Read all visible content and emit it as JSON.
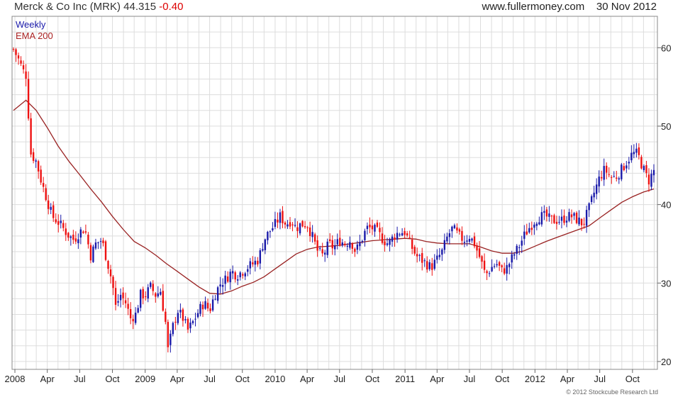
{
  "header": {
    "security": "Merck & Co Inc (MRK) 44.315",
    "change": "-0.40",
    "site": "www.fullermoney.com",
    "date": "30 Nov 2012"
  },
  "copyright": "© 2012 Stockcube Research Ltd",
  "colors": {
    "up_candle": "#1a1aaa",
    "down_candle": "#ee1111",
    "ema_line": "#992222",
    "grid": "#dddddd",
    "frame": "#888888"
  },
  "chart_data": {
    "type": "candlestick",
    "legend": [
      "Weekly",
      "EMA 200"
    ],
    "grid": true,
    "y_axis_side": "right",
    "ylim": [
      19,
      64
    ],
    "y_ticks": [
      20,
      30,
      40,
      50,
      60
    ],
    "x_domain": [
      "2007-12-24",
      "2012-12-10"
    ],
    "x_ticks": [
      {
        "label": "2008",
        "date": "2008-01-01"
      },
      {
        "label": "Apr",
        "date": "2008-04-01"
      },
      {
        "label": "Jul",
        "date": "2008-07-01"
      },
      {
        "label": "Oct",
        "date": "2008-10-01"
      },
      {
        "label": "2009",
        "date": "2009-01-01"
      },
      {
        "label": "Apr",
        "date": "2009-04-01"
      },
      {
        "label": "Jul",
        "date": "2009-07-01"
      },
      {
        "label": "Oct",
        "date": "2009-10-01"
      },
      {
        "label": "2010",
        "date": "2010-01-01"
      },
      {
        "label": "Apr",
        "date": "2010-04-01"
      },
      {
        "label": "Jul",
        "date": "2010-07-01"
      },
      {
        "label": "Oct",
        "date": "2010-10-01"
      },
      {
        "label": "2011",
        "date": "2011-01-01"
      },
      {
        "label": "Apr",
        "date": "2011-04-01"
      },
      {
        "label": "Jul",
        "date": "2011-07-01"
      },
      {
        "label": "Oct",
        "date": "2011-10-01"
      },
      {
        "label": "2012",
        "date": "2012-01-01"
      },
      {
        "label": "Apr",
        "date": "2012-04-01"
      },
      {
        "label": "Jul",
        "date": "2012-07-01"
      },
      {
        "label": "Oct",
        "date": "2012-10-01"
      }
    ],
    "series": [
      {
        "name": "Weekly",
        "kind": "weekly candles (close path)",
        "points": [
          [
            "2007-12-28",
            59.8
          ],
          [
            "2008-01-11",
            58.5
          ],
          [
            "2008-01-25",
            57.0
          ],
          [
            "2008-02-01",
            56.5
          ],
          [
            "2008-02-15",
            46.5
          ],
          [
            "2008-03-01",
            45.5
          ],
          [
            "2008-03-15",
            43.0
          ],
          [
            "2008-04-01",
            40.5
          ],
          [
            "2008-04-15",
            38.5
          ],
          [
            "2008-05-01",
            37.8
          ],
          [
            "2008-05-15",
            37.0
          ],
          [
            "2008-06-01",
            36.0
          ],
          [
            "2008-06-15",
            35.5
          ],
          [
            "2008-07-01",
            36.5
          ],
          [
            "2008-07-15",
            37.0
          ],
          [
            "2008-08-01",
            33.5
          ],
          [
            "2008-08-15",
            35.0
          ],
          [
            "2008-09-01",
            35.5
          ],
          [
            "2008-09-15",
            33.0
          ],
          [
            "2008-10-01",
            30.0
          ],
          [
            "2008-10-10",
            27.0
          ],
          [
            "2008-10-24",
            28.5
          ],
          [
            "2008-11-07",
            27.5
          ],
          [
            "2008-11-21",
            25.5
          ],
          [
            "2008-12-05",
            26.0
          ],
          [
            "2008-12-19",
            28.5
          ],
          [
            "2009-01-02",
            28.5
          ],
          [
            "2009-01-16",
            29.5
          ],
          [
            "2009-01-30",
            28.5
          ],
          [
            "2009-02-13",
            29.0
          ],
          [
            "2009-02-27",
            25.0
          ],
          [
            "2009-03-06",
            21.5
          ],
          [
            "2009-03-20",
            24.5
          ],
          [
            "2009-04-03",
            26.5
          ],
          [
            "2009-04-17",
            25.5
          ],
          [
            "2009-05-01",
            24.0
          ],
          [
            "2009-05-15",
            25.0
          ],
          [
            "2009-06-01",
            26.5
          ],
          [
            "2009-06-15",
            27.5
          ],
          [
            "2009-07-01",
            26.5
          ],
          [
            "2009-07-15",
            28.5
          ],
          [
            "2009-08-01",
            30.0
          ],
          [
            "2009-08-15",
            30.5
          ],
          [
            "2009-09-01",
            31.5
          ],
          [
            "2009-09-15",
            31.0
          ],
          [
            "2009-10-01",
            31.5
          ],
          [
            "2009-10-15",
            32.0
          ],
          [
            "2009-11-01",
            32.5
          ],
          [
            "2009-11-15",
            33.0
          ],
          [
            "2009-12-01",
            35.5
          ],
          [
            "2009-12-15",
            36.5
          ],
          [
            "2010-01-01",
            37.5
          ],
          [
            "2010-01-15",
            38.5
          ],
          [
            "2010-02-01",
            37.5
          ],
          [
            "2010-02-15",
            38.0
          ],
          [
            "2010-03-01",
            37.0
          ],
          [
            "2010-03-15",
            37.5
          ],
          [
            "2010-04-01",
            37.5
          ],
          [
            "2010-04-15",
            36.0
          ],
          [
            "2010-05-01",
            34.0
          ],
          [
            "2010-05-15",
            33.5
          ],
          [
            "2010-06-01",
            35.0
          ],
          [
            "2010-06-15",
            34.5
          ],
          [
            "2010-07-01",
            35.5
          ],
          [
            "2010-07-15",
            35.0
          ],
          [
            "2010-08-01",
            35.5
          ],
          [
            "2010-08-15",
            34.0
          ],
          [
            "2010-09-01",
            35.5
          ],
          [
            "2010-09-15",
            37.0
          ],
          [
            "2010-10-01",
            37.0
          ],
          [
            "2010-10-15",
            36.5
          ],
          [
            "2010-11-01",
            35.5
          ],
          [
            "2010-11-15",
            35.0
          ],
          [
            "2010-12-01",
            36.0
          ],
          [
            "2010-12-15",
            36.5
          ],
          [
            "2011-01-01",
            36.5
          ],
          [
            "2011-01-15",
            35.0
          ],
          [
            "2011-02-01",
            33.5
          ],
          [
            "2011-02-15",
            33.0
          ],
          [
            "2011-03-01",
            32.5
          ],
          [
            "2011-03-15",
            32.0
          ],
          [
            "2011-04-01",
            33.0
          ],
          [
            "2011-04-15",
            34.0
          ],
          [
            "2011-05-01",
            36.0
          ],
          [
            "2011-05-15",
            37.0
          ],
          [
            "2011-06-01",
            36.0
          ],
          [
            "2011-06-15",
            35.5
          ],
          [
            "2011-07-01",
            36.0
          ],
          [
            "2011-07-15",
            35.0
          ],
          [
            "2011-08-01",
            33.0
          ],
          [
            "2011-08-15",
            31.0
          ],
          [
            "2011-09-01",
            32.0
          ],
          [
            "2011-09-15",
            32.5
          ],
          [
            "2011-10-01",
            31.5
          ],
          [
            "2011-10-15",
            32.0
          ],
          [
            "2011-11-01",
            33.5
          ],
          [
            "2011-11-15",
            34.5
          ],
          [
            "2011-12-01",
            36.0
          ],
          [
            "2011-12-15",
            37.0
          ],
          [
            "2012-01-01",
            38.0
          ],
          [
            "2012-01-15",
            38.5
          ],
          [
            "2012-02-01",
            38.5
          ],
          [
            "2012-02-15",
            38.0
          ],
          [
            "2012-03-01",
            38.0
          ],
          [
            "2012-03-15",
            38.0
          ],
          [
            "2012-04-01",
            38.5
          ],
          [
            "2012-04-15",
            38.5
          ],
          [
            "2012-05-01",
            38.0
          ],
          [
            "2012-05-15",
            37.5
          ],
          [
            "2012-06-01",
            39.5
          ],
          [
            "2012-06-15",
            41.5
          ],
          [
            "2012-07-01",
            43.5
          ],
          [
            "2012-07-15",
            44.5
          ],
          [
            "2012-08-01",
            43.5
          ],
          [
            "2012-08-15",
            43.5
          ],
          [
            "2012-09-01",
            44.5
          ],
          [
            "2012-09-15",
            45.5
          ],
          [
            "2012-10-01",
            46.5
          ],
          [
            "2012-10-15",
            46.5
          ],
          [
            "2012-11-01",
            44.5
          ],
          [
            "2012-11-15",
            43.0
          ],
          [
            "2012-11-30",
            44.3
          ]
        ]
      },
      {
        "name": "EMA 200",
        "kind": "line",
        "points": [
          [
            "2007-12-28",
            52.0
          ],
          [
            "2008-02-01",
            53.3
          ],
          [
            "2008-03-01",
            52.0
          ],
          [
            "2008-04-01",
            49.8
          ],
          [
            "2008-05-01",
            47.5
          ],
          [
            "2008-06-01",
            45.5
          ],
          [
            "2008-07-01",
            43.8
          ],
          [
            "2008-08-01",
            42.0
          ],
          [
            "2008-09-01",
            40.3
          ],
          [
            "2008-10-01",
            38.5
          ],
          [
            "2008-11-01",
            36.8
          ],
          [
            "2008-12-01",
            35.3
          ],
          [
            "2009-01-01",
            34.5
          ],
          [
            "2009-02-01",
            33.5
          ],
          [
            "2009-03-01",
            32.5
          ],
          [
            "2009-04-01",
            31.5
          ],
          [
            "2009-05-01",
            30.5
          ],
          [
            "2009-06-01",
            29.5
          ],
          [
            "2009-07-01",
            28.7
          ],
          [
            "2009-08-01",
            28.6
          ],
          [
            "2009-09-01",
            29.0
          ],
          [
            "2009-10-01",
            29.6
          ],
          [
            "2009-11-01",
            30.1
          ],
          [
            "2009-12-01",
            30.8
          ],
          [
            "2010-01-01",
            31.8
          ],
          [
            "2010-02-01",
            32.8
          ],
          [
            "2010-03-01",
            33.7
          ],
          [
            "2010-04-01",
            34.3
          ],
          [
            "2010-05-01",
            34.6
          ],
          [
            "2010-06-01",
            34.7
          ],
          [
            "2010-07-01",
            34.8
          ],
          [
            "2010-08-01",
            35.0
          ],
          [
            "2010-09-01",
            35.2
          ],
          [
            "2010-10-01",
            35.4
          ],
          [
            "2010-11-01",
            35.5
          ],
          [
            "2010-12-01",
            35.6
          ],
          [
            "2011-01-01",
            35.7
          ],
          [
            "2011-02-01",
            35.6
          ],
          [
            "2011-03-01",
            35.3
          ],
          [
            "2011-04-01",
            35.1
          ],
          [
            "2011-05-01",
            35.0
          ],
          [
            "2011-06-01",
            35.0
          ],
          [
            "2011-07-01",
            35.0
          ],
          [
            "2011-08-01",
            34.6
          ],
          [
            "2011-09-01",
            34.1
          ],
          [
            "2011-10-01",
            33.8
          ],
          [
            "2011-11-01",
            33.8
          ],
          [
            "2011-12-01",
            34.1
          ],
          [
            "2012-01-01",
            34.7
          ],
          [
            "2012-02-01",
            35.3
          ],
          [
            "2012-03-01",
            35.8
          ],
          [
            "2012-04-01",
            36.3
          ],
          [
            "2012-05-01",
            36.8
          ],
          [
            "2012-06-01",
            37.3
          ],
          [
            "2012-07-01",
            38.3
          ],
          [
            "2012-08-01",
            39.3
          ],
          [
            "2012-09-01",
            40.3
          ],
          [
            "2012-10-01",
            41.0
          ],
          [
            "2012-11-01",
            41.6
          ],
          [
            "2012-11-30",
            42.0
          ]
        ]
      }
    ]
  }
}
